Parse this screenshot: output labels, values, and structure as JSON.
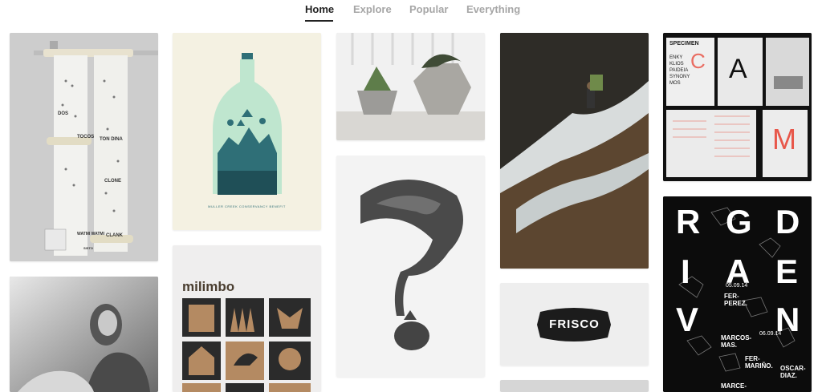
{
  "nav": {
    "tabs": [
      {
        "label": "Home",
        "active": true
      },
      {
        "label": "Explore",
        "active": false
      },
      {
        "label": "Popular",
        "active": false
      },
      {
        "label": "Everything",
        "active": false
      }
    ]
  },
  "cards": {
    "bottle_poster": {
      "caption": "MULLER CREEK CONSERVANCY BENEFIT"
    },
    "milimbo": {
      "title": "milimbo"
    },
    "type_specimen": {
      "lines": [
        "SPECIMEN",
        "ENKY",
        "KLIOS",
        "PAIDEIA",
        "SYNONY",
        "MOS"
      ],
      "letter_a": "A",
      "letter_c": "C",
      "letter_m": "M"
    },
    "frisco": {
      "label": "FRISCO"
    },
    "rgd_poster": {
      "big_letters": [
        "R",
        "G",
        "D",
        "I",
        "A",
        "E",
        "V",
        "E",
        "N"
      ],
      "date1": "05.09.14",
      "date2": "06.09.14",
      "name1": "FER-\nPEREZ.",
      "name2": "MARCOS-\nMAS.",
      "name3": "FER-\nMARIÑO.",
      "name4": "OSCAR-\nDIAZ.",
      "name5": "MARCE-"
    },
    "scroll_doc": {
      "words": [
        "DOS",
        "TON DINA",
        "TOCOS",
        "CLONE",
        "WATMI WATMI",
        "CLANK",
        "SISTO"
      ]
    }
  },
  "colors": {
    "nav_active": "#222222",
    "nav_inactive": "#a6a6a6",
    "accent_red": "#e8574a",
    "poster_teal": "#2f6f77",
    "poster_mint": "#bfe6cf"
  }
}
